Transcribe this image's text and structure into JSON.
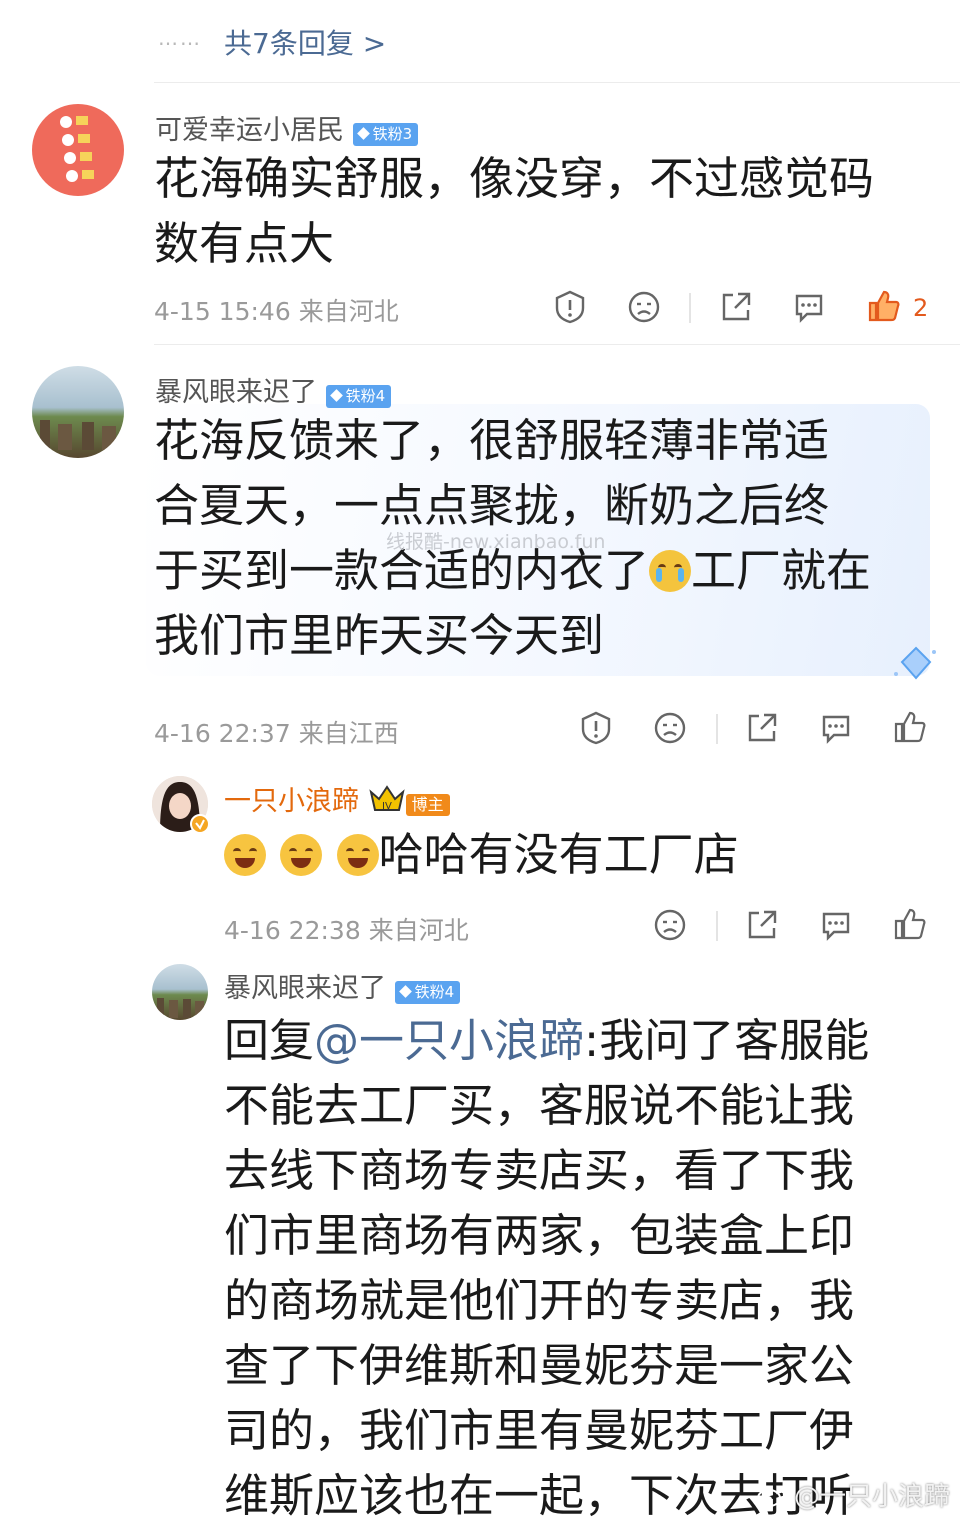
{
  "replies_link": {
    "dots": "……",
    "label": "共7条回复 >"
  },
  "comments": [
    {
      "username": "可爱幸运小居民",
      "badge": "铁粉3",
      "text_lines": [
        "花海确实舒服，像没穿，不过感觉码",
        "数有点大"
      ],
      "time": "4-15 15:46",
      "location": "来自河北",
      "like_count": "2"
    },
    {
      "username": "暴风眼来迟了",
      "badge": "铁粉4",
      "text_lines": [
        "花海反馈来了，很舒服轻薄非常适",
        "合夏天，一点点聚拢，断奶之后终",
        "于买到一款合适的内衣了",
        "工厂就在",
        "我们市里昨天买今天到"
      ],
      "watermark": "线报酷-new.xianbao.fun",
      "time": "4-16 22:37",
      "location": "来自江西"
    },
    {
      "username": "一只小浪蹄",
      "owner_badge": "博主",
      "text": "哈哈有没有工厂店",
      "time": "4-16 22:38",
      "location": "来自河北"
    },
    {
      "username": "暴风眼来迟了",
      "badge": "铁粉4",
      "reply_prefix": "回复",
      "mention": "@一只小浪蹄",
      "first_line_rest": ":我问了客服能",
      "text_lines": [
        "不能去工厂买，客服说不能让我",
        "去线下商场专卖店买，看了下我",
        "们市里商场有两家，包装盒上印",
        "的商场就是他们开的专卖店，我",
        "查了下伊维斯和曼妮芬是一家公",
        "司的，我们市里有曼妮芬工厂伊",
        "维斯应该也在一起，下次去打听"
      ]
    }
  ],
  "footer_watermark": "@一只小浪蹄",
  "colors": {
    "link": "#4b6a93",
    "owner": "#e3690d",
    "like": "#e35a1d",
    "badge": "#5aa3f0"
  }
}
